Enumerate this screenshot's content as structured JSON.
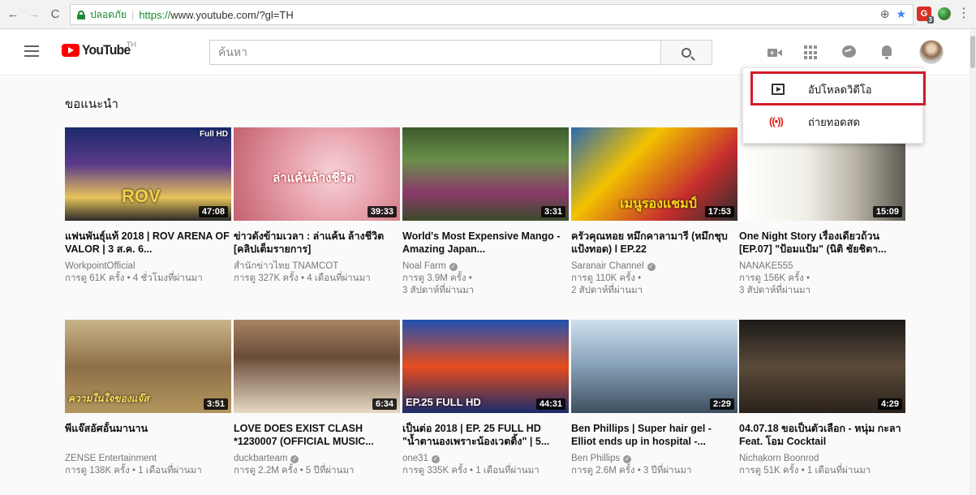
{
  "browser": {
    "back": "←",
    "forward": "→",
    "reload": "C",
    "secure_label": "ปลอดภัย",
    "url_proto": "https://",
    "url_rest": "www.youtube.com/?gl=TH",
    "zoom_icon": "⊕",
    "star_icon": "★",
    "extension_badge": "G",
    "extension_count": "3",
    "menu_icon": "⋮"
  },
  "header": {
    "logo_text": "YouTube",
    "region": "TH",
    "search_placeholder": "ค้นหา"
  },
  "section": {
    "title": "ขอแนะนำ"
  },
  "videos": [
    {
      "title": "แฟนพันธุ์แท้ 2018 | ROV ARENA OF VALOR | 3 ส.ค. 6...",
      "channel": "WorkpointOfficial",
      "verified": false,
      "meta1": "การดู 61K ครั้ง • 4 ชั่วโมงที่ผ่านมา",
      "meta2": "",
      "duration": "47:08",
      "hd": "Full HD",
      "overlay": "ROV"
    },
    {
      "title": "ข่าวดังข้ามเวลา : ล่าแค้น ล้างชีวิต [คลิปเต็มรายการ]",
      "channel": "สำนักข่าวไทย TNAMCOT",
      "verified": false,
      "meta1": "การดู 327K ครั้ง • 4 เดือนที่ผ่านมา",
      "meta2": "",
      "duration": "39:33",
      "hd": "",
      "overlay": "ล่าแค้นล้างชีวิต"
    },
    {
      "title": "World's Most Expensive Mango - Amazing Japan...",
      "channel": "Noal Farm",
      "verified": true,
      "meta1": "การดู 3.9M ครั้ง •",
      "meta2": "3 สัปดาห์ที่ผ่านมา",
      "duration": "3:31",
      "hd": "",
      "overlay": ""
    },
    {
      "title": "ครัวคุณหอย หมึกคาลามารี (หมึกชุบแป้งทอด) l EP.22",
      "channel": "Saranair Channel",
      "verified": true,
      "meta1": "การดู 110K ครั้ง •",
      "meta2": "2 สัปดาห์ที่ผ่านมา",
      "duration": "17:53",
      "hd": "",
      "overlay": "เมนูรองแชมป์"
    },
    {
      "title": "One Night Story เรื่องเดียวถ้วน [EP.07] \"ป้อมแป้ม\" (นิติ ชัยชิตา...",
      "channel": "NANAKE555",
      "verified": false,
      "meta1": "การดู 156K ครั้ง •",
      "meta2": "3 สัปดาห์ที่ผ่านมา",
      "duration": "15:09",
      "hd": "",
      "overlay": ""
    },
    {
      "title": "พีแจ๊สอัศอั้นมานาน",
      "channel": "ZENSE Entertainment",
      "verified": false,
      "meta1": "การดู 138K ครั้ง • 1 เดือนที่ผ่านมา",
      "meta2": "",
      "duration": "3:51",
      "hd": "",
      "overlay": "ความในใจของแจ๊ส"
    },
    {
      "title": "LOVE DOES EXIST CLASH *1230007 (OFFICIAL MUSIC...",
      "channel": "duckbarteam",
      "verified": true,
      "meta1": "การดู 2.2M ครั้ง • 5 ปีที่ผ่านมา",
      "meta2": "",
      "duration": "6:34",
      "hd": "",
      "overlay": ""
    },
    {
      "title": "เป็นต่อ 2018 | EP. 25 FULL HD \"น้ำตานองเพราะน้องเวตติ้ง\" | 5...",
      "channel": "one31",
      "verified": true,
      "meta1": "การดู 335K ครั้ง • 1 เดือนที่ผ่านมา",
      "meta2": "",
      "duration": "44:31",
      "hd": "",
      "overlay": "EP.25 FULL HD"
    },
    {
      "title": "Ben Phillips | Super hair gel - Elliot ends up in hospital -...",
      "channel": "Ben Phillips",
      "verified": true,
      "meta1": "การดู 2.6M ครั้ง • 3 ปีที่ผ่านมา",
      "meta2": "",
      "duration": "2:29",
      "hd": "",
      "overlay": ""
    },
    {
      "title": "04.07.18 ขอเป็นตัวเลือก - หนุ่ม กะลา Feat. โอม Cocktail",
      "channel": "Nichakorn Boonrod",
      "verified": false,
      "meta1": "การดู 51K ครั้ง • 1 เดือนที่ผ่านมา",
      "meta2": "",
      "duration": "4:29",
      "hd": "",
      "overlay": ""
    }
  ],
  "dropdown": {
    "upload_label": "อัปโหลดวิดีโอ",
    "live_label": "ถ่ายทอดสด",
    "live_icon": "((•))"
  },
  "colors": {
    "brand": "#ff0000",
    "highlight": "#d31c2a",
    "secure": "#1a8a34"
  }
}
